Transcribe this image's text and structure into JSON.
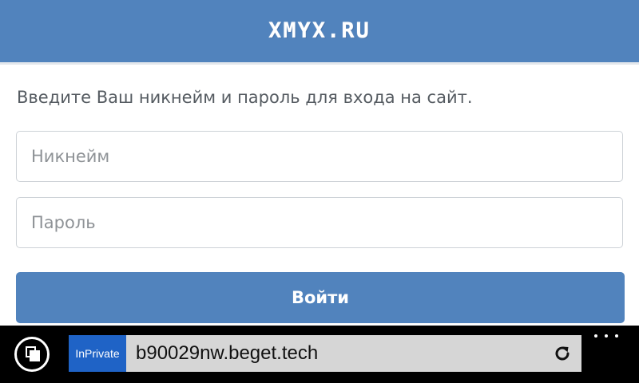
{
  "header": {
    "logo_text": "XMYX.RU",
    "background": "#5183bd"
  },
  "login": {
    "prompt": "Введите Ваш никнейм и пароль для входа на сайт.",
    "nickname_placeholder": "Никнейм",
    "nickname_value": "",
    "password_placeholder": "Пароль",
    "password_value": "",
    "submit_label": "Войти",
    "accent": "#5183bd"
  },
  "browser": {
    "tabs_icon": "tabs-icon",
    "inprivate_label": "InPrivate",
    "inprivate_color": "#1f63c6",
    "url": "b90029nw.beget.tech",
    "refresh_icon": "refresh-icon",
    "more_icon": "more-icon"
  }
}
